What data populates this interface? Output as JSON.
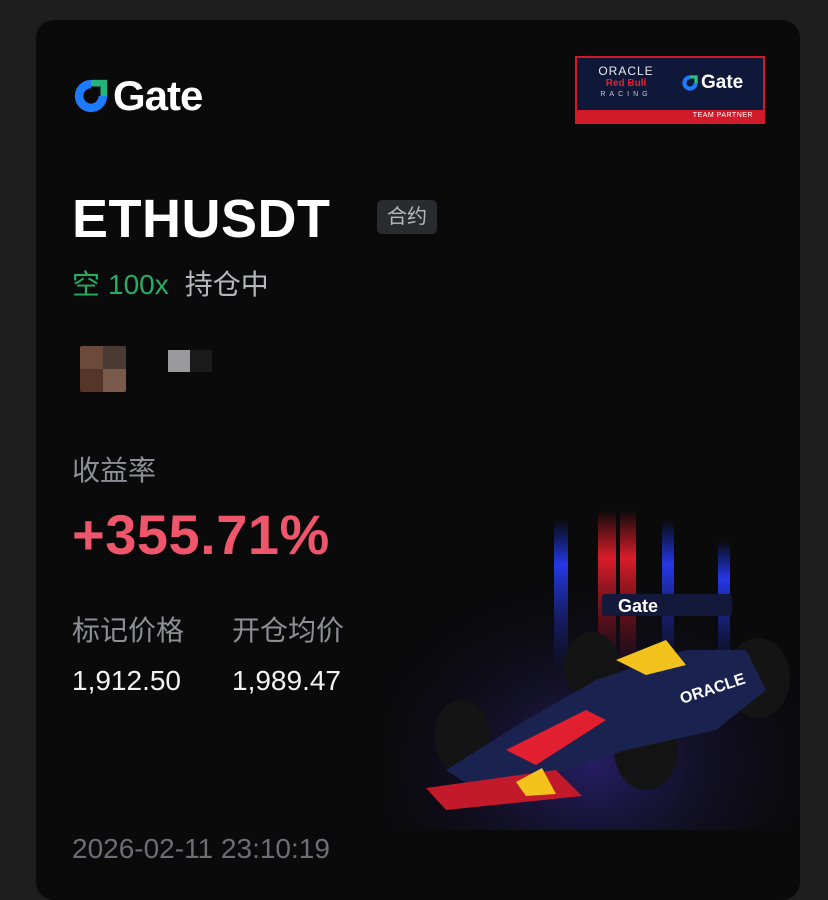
{
  "brand": {
    "logo_text": "Gate",
    "accent_blue": "#1e7bff",
    "partner": {
      "oracle": "ORACLE",
      "redbull": "Red Bull",
      "racing": "RACING",
      "gate": "Gate",
      "team": "TEAM PARTNER"
    }
  },
  "contract": {
    "pair": "ETHUSDT",
    "type_tag": "合约",
    "direction": "空",
    "leverage": "100x",
    "status": "持仓中"
  },
  "stats": {
    "roi_label": "收益率",
    "roi_value": "+355.71%",
    "mark_price_label": "标记价格",
    "mark_price": "1,912.50",
    "entry_price_label": "开仓均价",
    "entry_price": "1,989.47"
  },
  "timestamp": "2026-02-11 23:10:19",
  "colors": {
    "profit": "#f0566b",
    "short": "#24ae64",
    "card_bg": "#0a0a0b"
  },
  "illustration": {
    "car_livery_text": "Gate",
    "car_sponsor_text": "ORACLE"
  }
}
